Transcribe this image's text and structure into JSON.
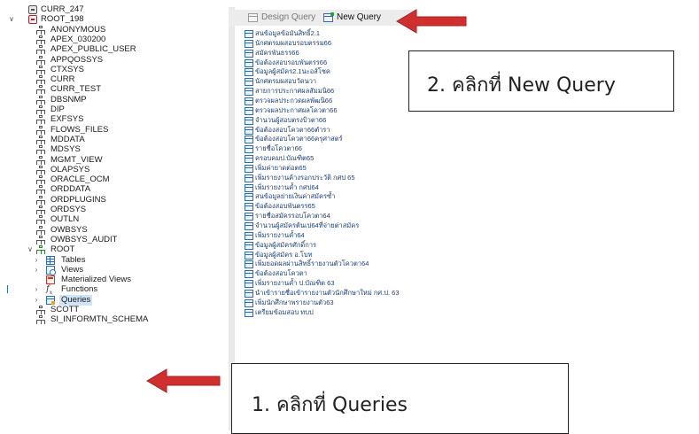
{
  "tree": {
    "top_connections": [
      {
        "label": "CURR_247",
        "style": "gray"
      },
      {
        "label": "ROOT_198",
        "style": "red",
        "expanded": true
      }
    ],
    "schemas": [
      "ANONYMOUS",
      "APEX_030200",
      "APEX_PUBLIC_USER",
      "APPQOSSYS",
      "CTXSYS",
      "CURR",
      "CURR_TEST",
      "DBSNMP",
      "DIP",
      "EXFSYS",
      "FLOWS_FILES",
      "MDDATA",
      "MDSYS",
      "MGMT_VIEW",
      "OLAPSYS",
      "ORACLE_OCM",
      "ORDDATA",
      "ORDPLUGINS",
      "ORDSYS",
      "OUTLN",
      "OWBSYS",
      "OWBSYS_AUDIT"
    ],
    "root_schema": {
      "label": "ROOT",
      "expanded": true
    },
    "root_children": [
      {
        "label": "Tables",
        "icon": "table-icon"
      },
      {
        "label": "Views",
        "icon": "view-icon"
      },
      {
        "label": "Materialized Views",
        "icon": "materialized-view-icon"
      },
      {
        "label": "Functions",
        "icon": "function-icon"
      },
      {
        "label": "Queries",
        "icon": "query-icon",
        "selected": true
      }
    ],
    "after": [
      "SCOTT",
      "SI_INFORMTN_SCHEMA"
    ]
  },
  "toolbar": {
    "design_query": "Design Query",
    "new_query": "New Query"
  },
  "queries": [
    "สนข้อมูลข้อมันสิทธิ์2.1",
    "นักศตรมผสอบรอบตรรม66",
    "สมัครพันธรร66",
    "ข้อต้องสอบรอบพันตรร66",
    "ข้อมูลผู้สมัคร2.1นะอส์โชค",
    "นักศตรมผสอบวัดนวา",
    "สายการประกาศผลสัมมนิ66",
    "ตรวจผลประกวดผลพัฒนิ66",
    "ตรวจผลประกาศผลโควตา66",
    "จำนวนผู้สอบตรงบิวตา66",
    "ข้อต้องสอบโควตา66ตำรา",
    "ข้อต้องสอบโควตา66ครุศาสตร์",
    "รายชื่อโควตา66",
    "ครอบคมป.บัณฑิต65",
    "เพิ่มค่ายาดต่อต65",
    "เพิ่มรายงานค้างรอกประวัติ กศป 65",
    "เพิ่มรายงานค้ำ กศป64",
    "สนข้อมูลย่ายเงินค่าสมัครซ้ำ",
    "ข้อต้องสอบพันตรร65",
    "รายชื่อสมัครรอบโควตา64",
    "จำนวนผู้สมัครต้นเป64ที่จ่ายต่าสมัคร",
    "เพิ่มรายงานค้ำ64",
    "ข้อมูลผู้สมัครศักดิ์การ",
    "ข้อมูลผู้สมัคร อ.โบท",
    "เพิ่มยอดผลผ่านสิทธิ์รายงานตัวโควตา64",
    "ข้อต้องสอบโควตา",
    "เพิ่มรายงานค้ำ ป.บัณฑิต 63",
    "นำเข้ารายชื่อเข้ารายงานตัวนักศึกษาใหม่ กศ.ป. 63",
    "เพิ่มนักศึกษาพรายงานตัว63",
    "เตรียมข้อมสอบ ทบป"
  ],
  "callouts": {
    "new_query": "2. คลิกที่ New Query",
    "queries": "1. คลิกที่ Queries"
  },
  "colors": {
    "arrow": "#cf2f2f",
    "selected_bg": "#cfe4f7",
    "query_text": "#1d3f77",
    "toolbar_bg": "#ececec"
  }
}
